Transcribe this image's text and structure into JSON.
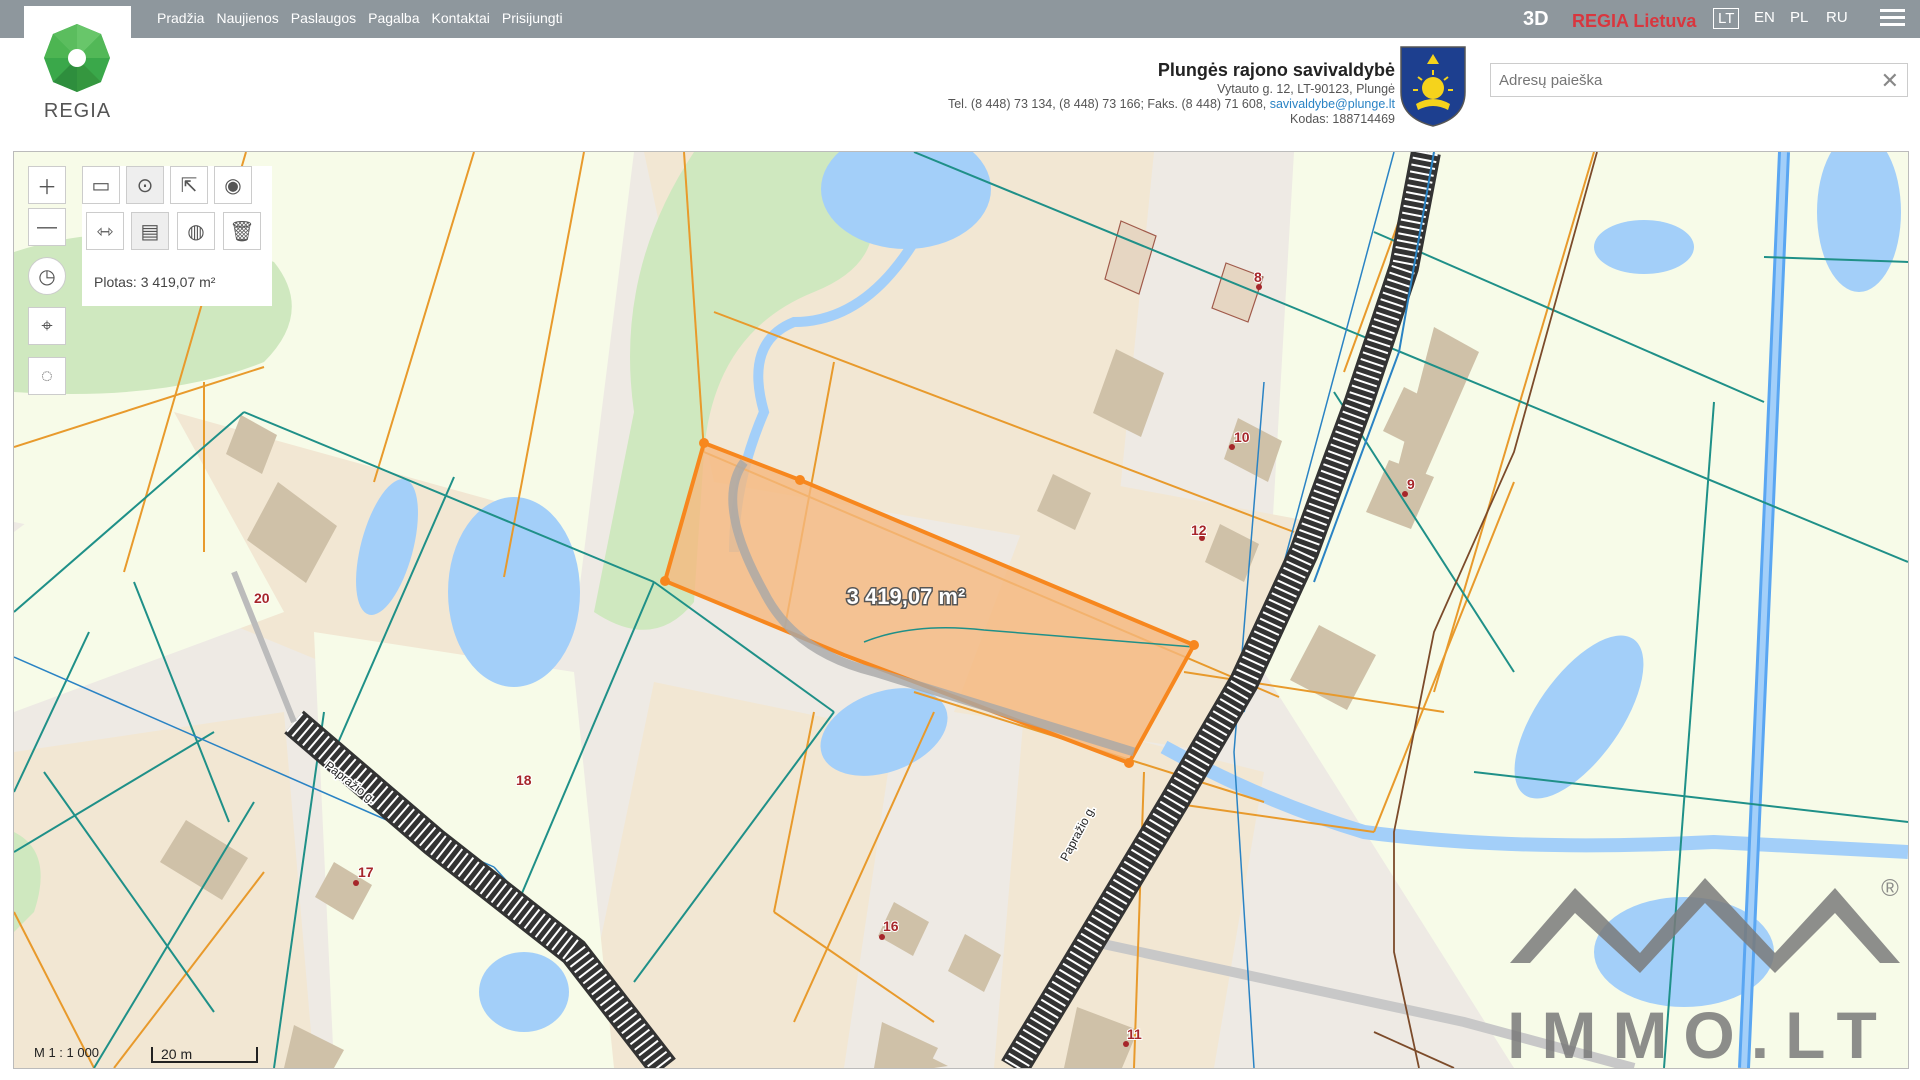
{
  "nav": {
    "items": [
      "Pradžia",
      "Naujienos",
      "Paslaugos",
      "Pagalba",
      "Kontaktai",
      "Prisijungti"
    ]
  },
  "brand": {
    "logo_text": "REGIA",
    "three_d": "3D",
    "regia_lt": "REGIA Lietuva"
  },
  "languages": [
    "LT",
    "EN",
    "PL",
    "RU"
  ],
  "municipality": {
    "title": "Plungės rajono savivaldybė",
    "address": "Vytauto g. 12, LT-90123, Plungė",
    "phones": "Tel. (8 448) 73 134, (8 448) 73 166; Faks. (8 448) 71 608,",
    "email": "savivaldybe@plunge.lt",
    "code": "Kodas: 188714469"
  },
  "search": {
    "placeholder": "Adresų paieška"
  },
  "measure": {
    "area_text": "Plotas: 3 419,07 m²",
    "map_label": "3 419,07 m²"
  },
  "map": {
    "scale_text": "M 1 : 1 000",
    "scalebar_text": "20 m",
    "street_label": "Papražio g.",
    "house_numbers": [
      "20",
      "18",
      "17",
      "16",
      "11",
      "10",
      "12",
      "9",
      "8"
    ]
  },
  "watermark": {
    "text": "IMMO.LT",
    "registered": "®"
  },
  "colors": {
    "topbar": "#8e979d",
    "parcel_fill": "#f5b87e",
    "parcel_stroke": "#f7871e",
    "water": "#a3cff9",
    "forest": "#cfe8bf",
    "boundary_orange": "#e89a2c",
    "boundary_teal": "#1f9088"
  }
}
